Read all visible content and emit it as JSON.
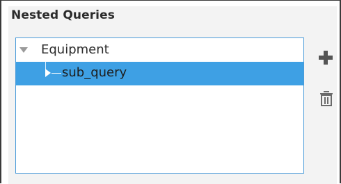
{
  "panel": {
    "title": "Nested Queries"
  },
  "tree": {
    "root": {
      "label": "Equipment",
      "expanded": true
    },
    "children": [
      {
        "label": "sub_query",
        "selected": true,
        "expanded": false
      }
    ]
  },
  "actions": {
    "add_icon": "plus-icon",
    "delete_icon": "trash-icon"
  },
  "colors": {
    "selection": "#3ea0e4",
    "tree_border": "#4a9bd9",
    "panel_background": "#f3f3f3"
  }
}
